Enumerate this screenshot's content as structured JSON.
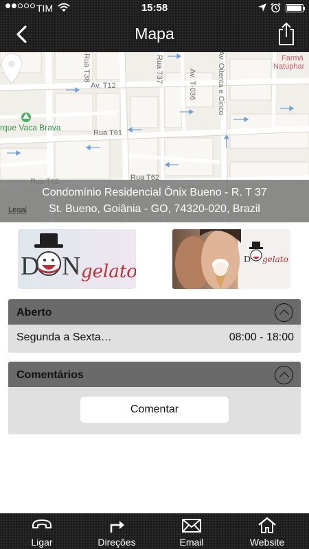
{
  "status_bar": {
    "carrier": "TIM",
    "time": "15:58",
    "signal_dots_filled": 2,
    "battery_level": 0.85
  },
  "nav": {
    "title": "Mapa"
  },
  "map": {
    "streets": {
      "rua_t38": "Rua T38",
      "av_t12": "Av. T12",
      "rua_t37": "Rua T37",
      "av_t036": "Av. T-036",
      "av_oitenta": "Av. Oitenta e Cinco",
      "rua_t61": "Rua T61",
      "rua_t62_left": "Rua T62",
      "rua_t62_center": "Rua T62"
    },
    "poi_park": "rque Vaca Brava",
    "poi_pharmacy_line1": "Farmá",
    "poi_pharmacy_line2": "Natuphar",
    "legal": "Legal",
    "address_line1": "Condomínio Residencial Ônix Bueno - R. T 37",
    "address_line2": "St. Bueno, Goiânia - GO, 74320-020, Brazil"
  },
  "banners": {
    "logo_text_1": "D",
    "logo_text_2": "N",
    "logo_text_3": "gelato",
    "logo_small": "DONgelato"
  },
  "hours_card": {
    "title": "Aberto",
    "days": "Segunda a Sexta…",
    "time": "08:00 - 18:00"
  },
  "comments_card": {
    "title": "Comentários",
    "button_label": "Comentar"
  },
  "tabs": [
    {
      "label": "Ligar",
      "icon": "phone-icon"
    },
    {
      "label": "Direções",
      "icon": "directions-icon"
    },
    {
      "label": "Email",
      "icon": "email-icon"
    },
    {
      "label": "Website",
      "icon": "home-icon"
    }
  ],
  "colors": {
    "header_bg": "#1c1c1c",
    "card_head": "#6a6a6a",
    "card_body": "#e0e0e0",
    "logo_red": "#b8323a"
  }
}
